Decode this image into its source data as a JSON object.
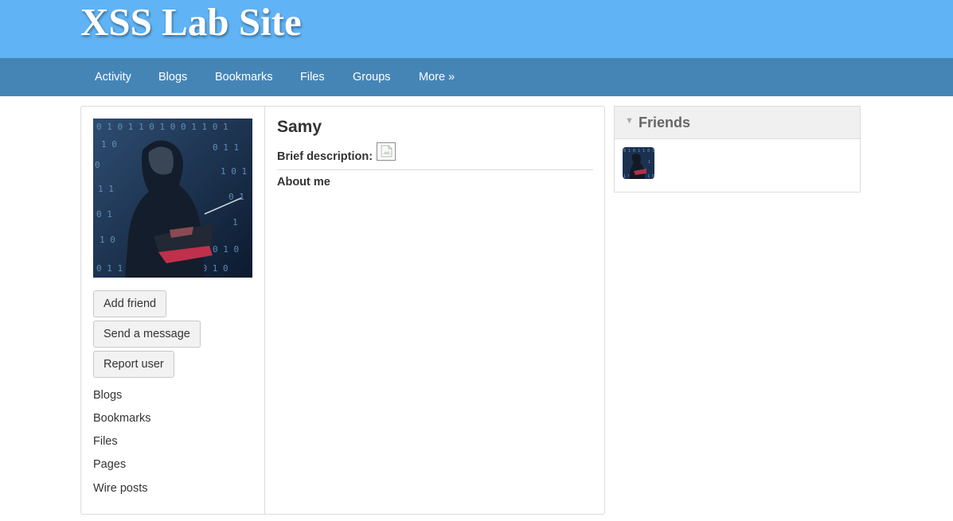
{
  "header": {
    "site_title": "XSS Lab Site",
    "bg_color": "#60b4f5"
  },
  "nav": {
    "bg_color": "#4585b6",
    "items": [
      {
        "label": "Activity"
      },
      {
        "label": "Blogs"
      },
      {
        "label": "Bookmarks"
      },
      {
        "label": "Files"
      },
      {
        "label": "Groups"
      },
      {
        "label": "More »"
      }
    ]
  },
  "profile": {
    "name": "Samy",
    "avatar_icon": "hacker-avatar-image",
    "brief_description_label": "Brief description:",
    "brief_description_icon": "broken-image-icon",
    "about_me_label": "About me",
    "buttons": {
      "add_friend": "Add friend",
      "send_message": "Send a message",
      "report_user": "Report user"
    },
    "links": [
      {
        "label": "Blogs"
      },
      {
        "label": "Bookmarks"
      },
      {
        "label": "Files"
      },
      {
        "label": "Pages"
      },
      {
        "label": "Wire posts"
      }
    ]
  },
  "friends": {
    "title": "Friends",
    "caret_icon": "triangle-down-icon",
    "items": [
      {
        "avatar_icon": "friend-avatar-image"
      }
    ]
  }
}
